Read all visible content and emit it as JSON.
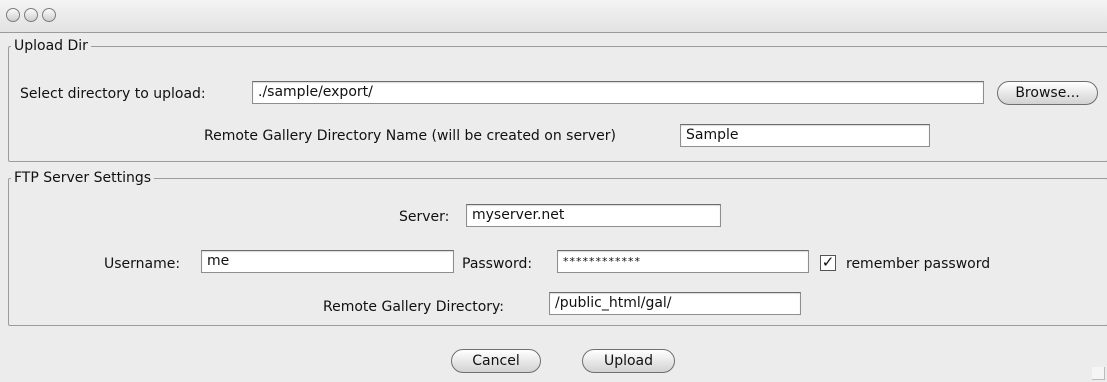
{
  "window": {
    "title": ""
  },
  "upload_dir": {
    "legend": "Upload Dir",
    "select_label": "Select directory to upload:",
    "directory_value": "./sample/export/",
    "browse_label": "Browse...",
    "remote_name_label": "Remote Gallery Directory Name (will be created on server)",
    "remote_name_value": "Sample"
  },
  "ftp": {
    "legend": "FTP Server Settings",
    "server_label": "Server:",
    "server_value": "myserver.net",
    "username_label": "Username:",
    "username_value": "me",
    "password_label": "Password:",
    "password_value": "************",
    "remember_label": "remember password",
    "remember_checked": true,
    "remote_dir_label": "Remote Gallery Directory:",
    "remote_dir_value": "/public_html/gal/"
  },
  "actions": {
    "cancel_label": "Cancel",
    "upload_label": "Upload"
  }
}
